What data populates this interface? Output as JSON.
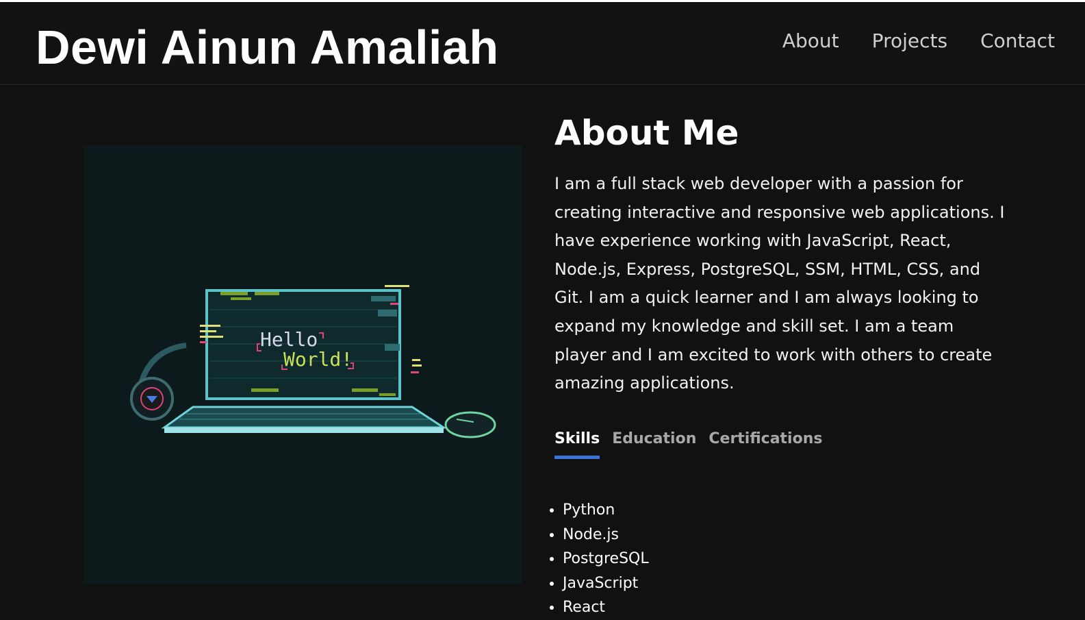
{
  "header": {
    "site_title": "Dewi Ainun Amaliah",
    "nav": [
      {
        "label": "About"
      },
      {
        "label": "Projects"
      },
      {
        "label": "Contact"
      }
    ]
  },
  "hero_image": {
    "screen_line1": "Hello",
    "screen_line2": "World!"
  },
  "about": {
    "heading": "About Me",
    "paragraph": "I am a full stack web developer with a passion for creating interactive and responsive web applications. I have experience working with JavaScript, React, Node.js, Express, PostgreSQL, SSM, HTML, CSS, and Git. I am a quick learner and I am always looking to expand my knowledge and skill set. I am a team player and I am excited to work with others to create amazing applications."
  },
  "tabs": [
    {
      "label": "Skills",
      "active": true
    },
    {
      "label": "Education",
      "active": false
    },
    {
      "label": "Certifications",
      "active": false
    }
  ],
  "skills": [
    "Python",
    "Node.js",
    "PostgreSQL",
    "JavaScript",
    "React"
  ],
  "colors": {
    "background": "#111111",
    "tab_active_underline": "#3b73d9",
    "image_background": "#0c1a1b"
  }
}
